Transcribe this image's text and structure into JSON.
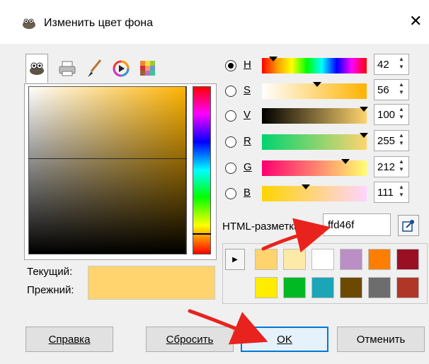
{
  "window": {
    "title": "Изменить цвет фона",
    "close_glyph": "✕"
  },
  "selector_tabs": [
    {
      "name": "gimp-selector",
      "icon": "wilber-icon"
    },
    {
      "name": "cmyk-selector",
      "icon": "printer-icon"
    },
    {
      "name": "watercolor-selector",
      "icon": "brush-icon"
    },
    {
      "name": "wheel-selector",
      "icon": "color-wheel-icon"
    },
    {
      "name": "palette-selector",
      "icon": "palette-icon"
    }
  ],
  "current_color": "#ffd46f",
  "labels": {
    "current": "Текущий:",
    "previous": "Прежний:",
    "html_notation": "HTML-разметка:"
  },
  "channels": [
    {
      "key": "H",
      "value": "42",
      "selected": true
    },
    {
      "key": "S",
      "value": "56",
      "selected": false
    },
    {
      "key": "V",
      "value": "100",
      "selected": false
    },
    {
      "key": "R",
      "value": "255",
      "selected": false
    },
    {
      "key": "G",
      "value": "212",
      "selected": false
    },
    {
      "key": "B",
      "value": "111",
      "selected": false
    }
  ],
  "hex_value": "ffd46f",
  "history_colors": [
    [
      "#ffd46f",
      "#fde9a8",
      "#ffffff",
      "#bb8fc6",
      "#ff7e00",
      "#9a0f24"
    ],
    [
      "#ffec00",
      "#00b923",
      "#1aa6b6",
      "#6b4a00",
      "#6d6d6d",
      "#b03628"
    ]
  ],
  "buttons": {
    "help": "Справка",
    "reset": "Сбросить",
    "ok": "OK",
    "cancel": "Отменить"
  },
  "annotation_color": "#e8231d"
}
